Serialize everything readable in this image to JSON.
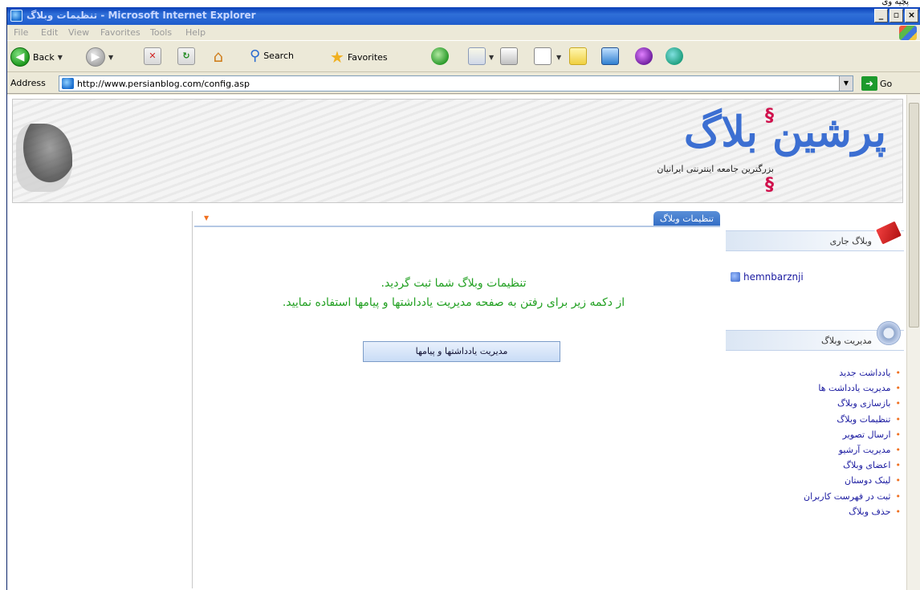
{
  "top_strip_text": "پچیه وی",
  "window": {
    "title": "تنظیمات وبلاگ - Microsoft Internet Explorer",
    "controls": [
      "_",
      "▫",
      "×"
    ]
  },
  "menu": {
    "items": [
      "File",
      "Edit",
      "View",
      "Favorites",
      "Tools",
      "Help"
    ]
  },
  "toolbar": {
    "back_label": "Back",
    "search_label": "Search",
    "favorites_label": "Favorites"
  },
  "address": {
    "label": "Address",
    "url": "http://www.persianblog.com/config.asp",
    "go_label": "Go"
  },
  "banner": {
    "logo_text": "پرشین بلاگ",
    "tagline": "بزرگترین جامعه اینترنتی ایرانیان"
  },
  "main": {
    "tab_label": "تنظیمات وبلاگ",
    "message_line1": "تنظیمات وبلاگ شما ثبت گردید.",
    "message_line2": "از دکمه زیر برای رفتن به صفحه مدیریت یادداشتها و پیامها استفاده نمایید.",
    "button_label": "مدیریت یادداشتها و پیامها"
  },
  "sidebar": {
    "current_blog_title": "وبلاگ جاری",
    "current_user": "hemnbarznji",
    "manage_title": "مدیریت وبلاگ",
    "items": [
      "یادداشت جدید",
      "مدیریت یادداشت ها",
      "بازسازی وبلاگ",
      "تنظیمات وبلاگ",
      "ارسال تصویر",
      "مدیریت آرشیو",
      "اعضای وبلاگ",
      "لینک دوستان",
      "ثبت در فهرست کاربران",
      "حذف وبلاگ"
    ]
  },
  "colors": {
    "message_green": "#22a022",
    "link_blue": "#1a1aa0",
    "bullet_orange": "#f07020",
    "tab_blue": "#2f6ac4"
  }
}
